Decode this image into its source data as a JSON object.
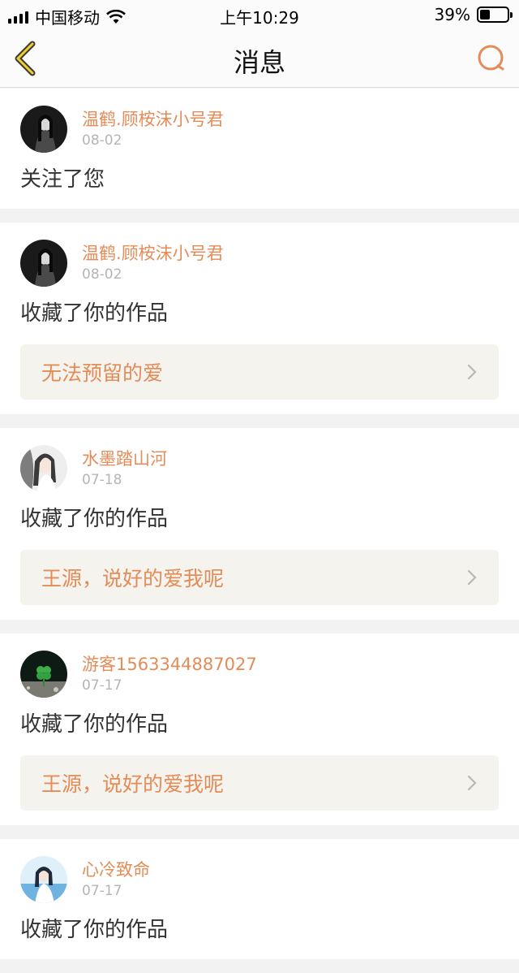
{
  "status": {
    "carrier": "中国移动",
    "time": "上午10:29",
    "battery": "39%",
    "battery_level": 0.39
  },
  "nav": {
    "title": "消息",
    "accent": "#e48c58"
  },
  "messages": [
    {
      "name": "温鹤.顾桉沫小号君",
      "date": "08-02",
      "action": "关注了您",
      "avatar": "dark-portrait-avatar"
    },
    {
      "name": "温鹤.顾桉沫小号君",
      "date": "08-02",
      "action": "收藏了你的作品",
      "work": "无法预留的爱",
      "avatar": "dark-portrait-avatar"
    },
    {
      "name": "水墨踏山河",
      "date": "07-18",
      "action": "收藏了你的作品",
      "work": "王源，说好的爱我呢",
      "avatar": "ink-portrait-avatar"
    },
    {
      "name": "游客1563344887027",
      "date": "07-17",
      "action": "收藏了你的作品",
      "work": "王源，说好的爱我呢",
      "avatar": "clover-avatar"
    },
    {
      "name": "心冷致命",
      "date": "07-17",
      "action": "收藏了你的作品",
      "avatar": "blue-portrait-avatar"
    }
  ]
}
